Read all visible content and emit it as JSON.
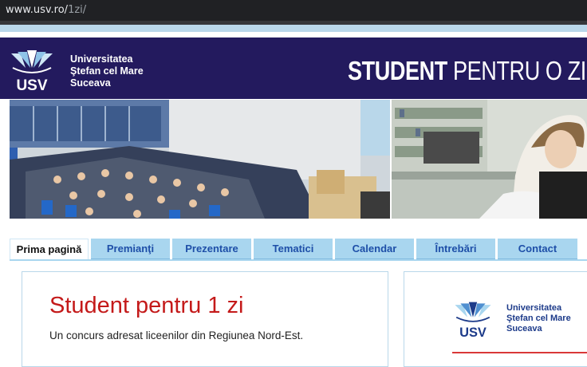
{
  "browser": {
    "url_host": "www.usv.ro/",
    "url_path": "1zi/"
  },
  "header": {
    "logo_text": "USV",
    "university_lines": [
      "Universitatea",
      "Ştefan cel Mare",
      "Suceava"
    ],
    "banner_bold": "STUDENT",
    "banner_rest": " PENTRU O ZI"
  },
  "nav": {
    "tabs": [
      "Prima pagină",
      "Premianţi",
      "Prezentare",
      "Tematici",
      "Calendar",
      "Întrebări",
      "Contact"
    ],
    "active_index": 0
  },
  "main": {
    "title": "Student pentru 1 zi",
    "subtitle": "Un concurs adresat liceenilor din Regiunea Nord-Est."
  },
  "sidebar_logo": {
    "logo_text": "USV",
    "university_lines": [
      "Universitatea",
      "Ştefan cel Mare",
      "Suceava"
    ]
  },
  "colors": {
    "header_bg": "#231a5e",
    "tab_bg": "#a9d6ef",
    "tab_text": "#1e4fa8",
    "title_red": "#c41a1a"
  }
}
